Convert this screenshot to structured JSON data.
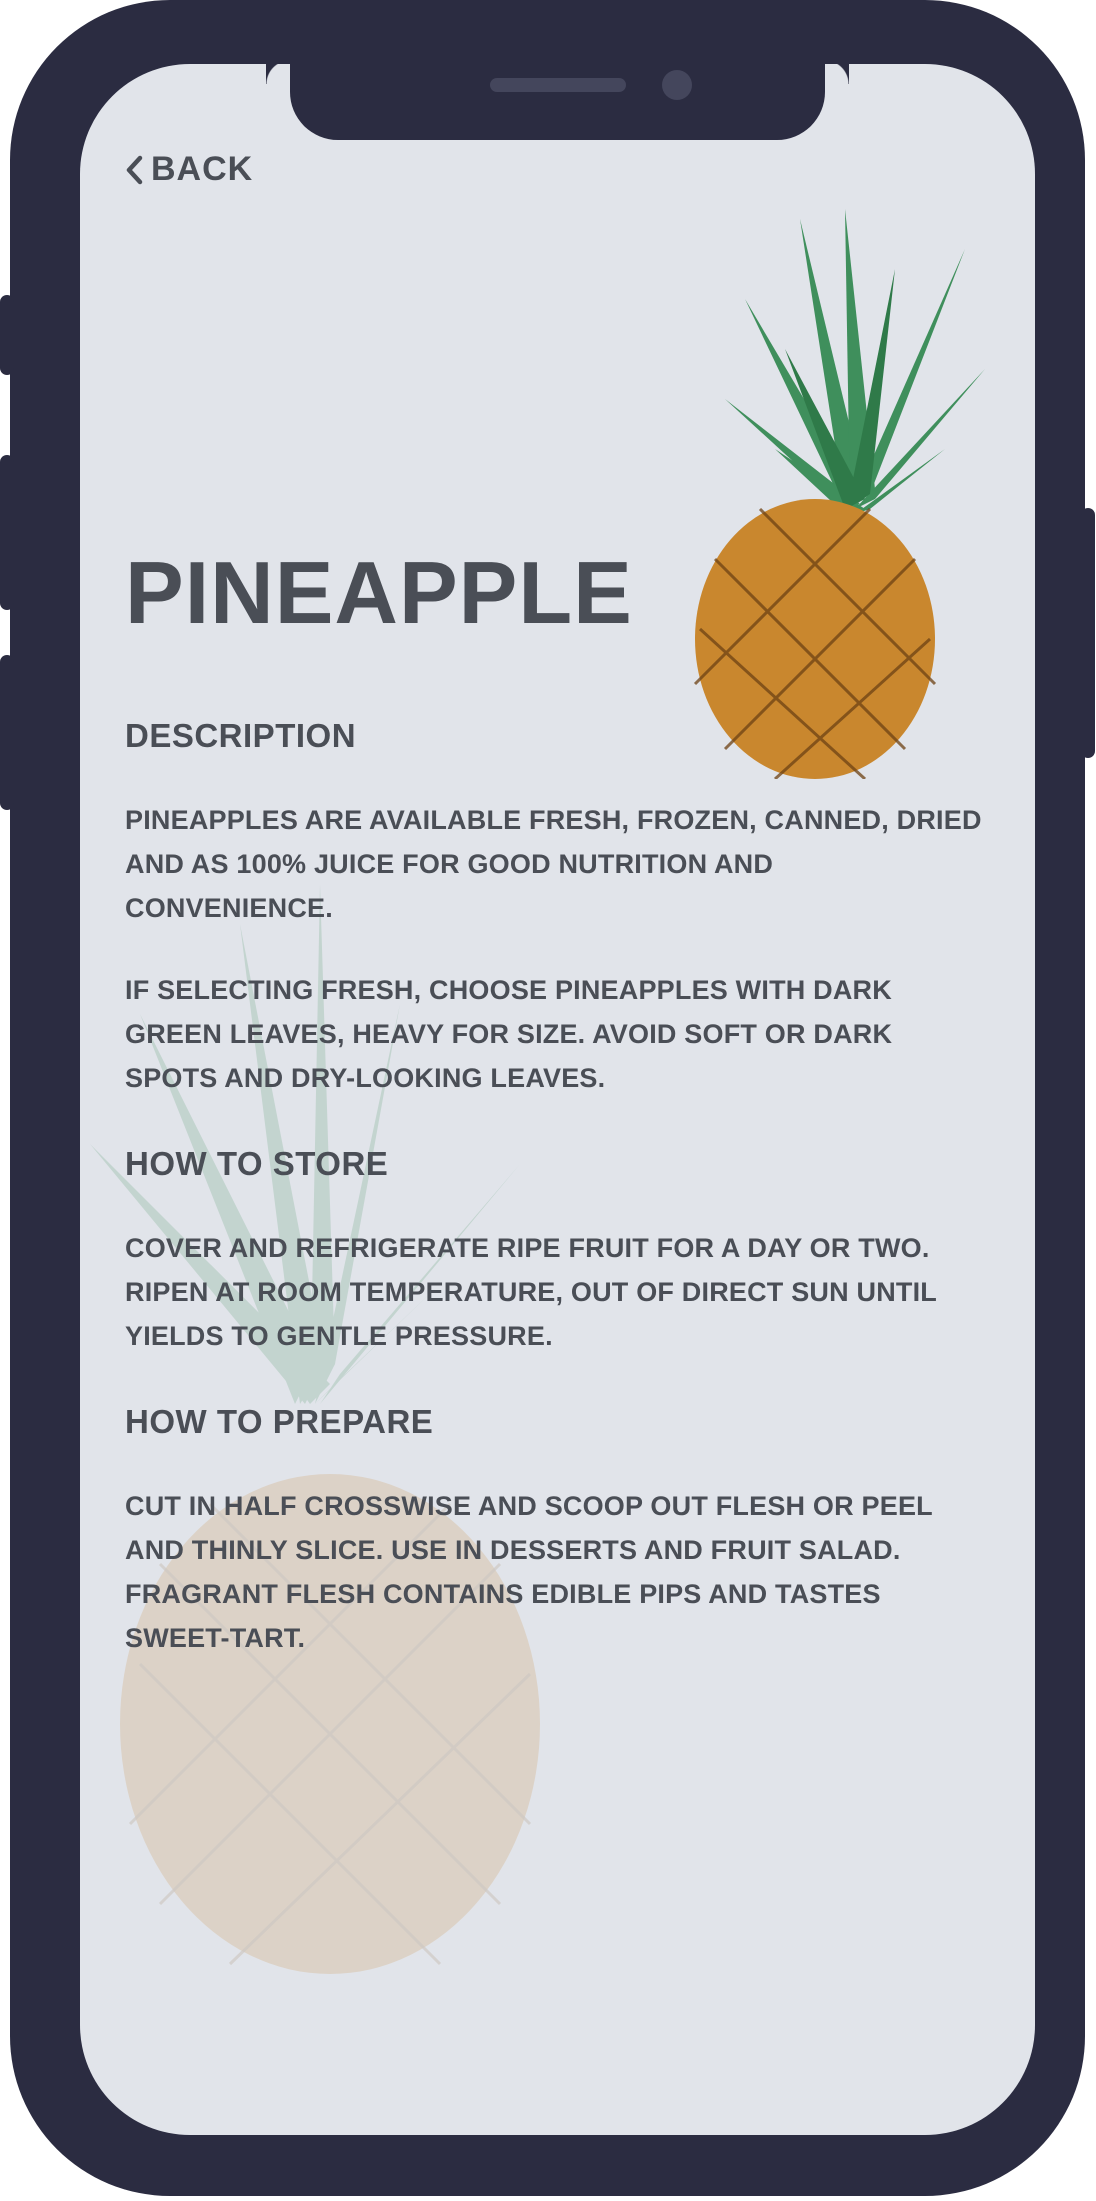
{
  "nav": {
    "back_label": "BACK",
    "back_icon": "chevron-left-icon"
  },
  "page": {
    "title": "PINEAPPLE"
  },
  "sections": {
    "description": {
      "heading": "DESCRIPTION",
      "paragraph1": "PINEAPPLES ARE AVAILABLE FRESH, FROZEN, CANNED, DRIED AND AS 100% JUICE FOR GOOD NUTRITION AND CONVENIENCE.",
      "paragraph2": "IF SELECTING FRESH, CHOOSE PINEAPPLES WITH DARK GREEN LEAVES, HEAVY FOR SIZE. AVOID SOFT OR DARK SPOTS AND DRY-LOOKING LEAVES."
    },
    "store": {
      "heading": "HOW TO STORE",
      "paragraph": "COVER AND REFRIGERATE RIPE FRUIT FOR A DAY OR TWO. RIPEN AT ROOM TEMPERATURE, OUT OF DIRECT SUN UNTIL YIELDS TO GENTLE PRESSURE."
    },
    "prepare": {
      "heading": "HOW TO PREPARE",
      "paragraph": "CUT IN HALF CROSSWISE AND SCOOP OUT FLESH OR PEEL AND THINLY SLICE. USE IN DESSERTS AND FRUIT SALAD. FRAGRANT FLESH CONTAINS EDIBLE PIPS AND TASTES SWEET-TART."
    }
  },
  "colors": {
    "device": "#2b2c41",
    "screen": "#e1e4ea",
    "text": "#4a4e56",
    "leaf": "#3f8f5c",
    "fruit": "#c9872e"
  }
}
